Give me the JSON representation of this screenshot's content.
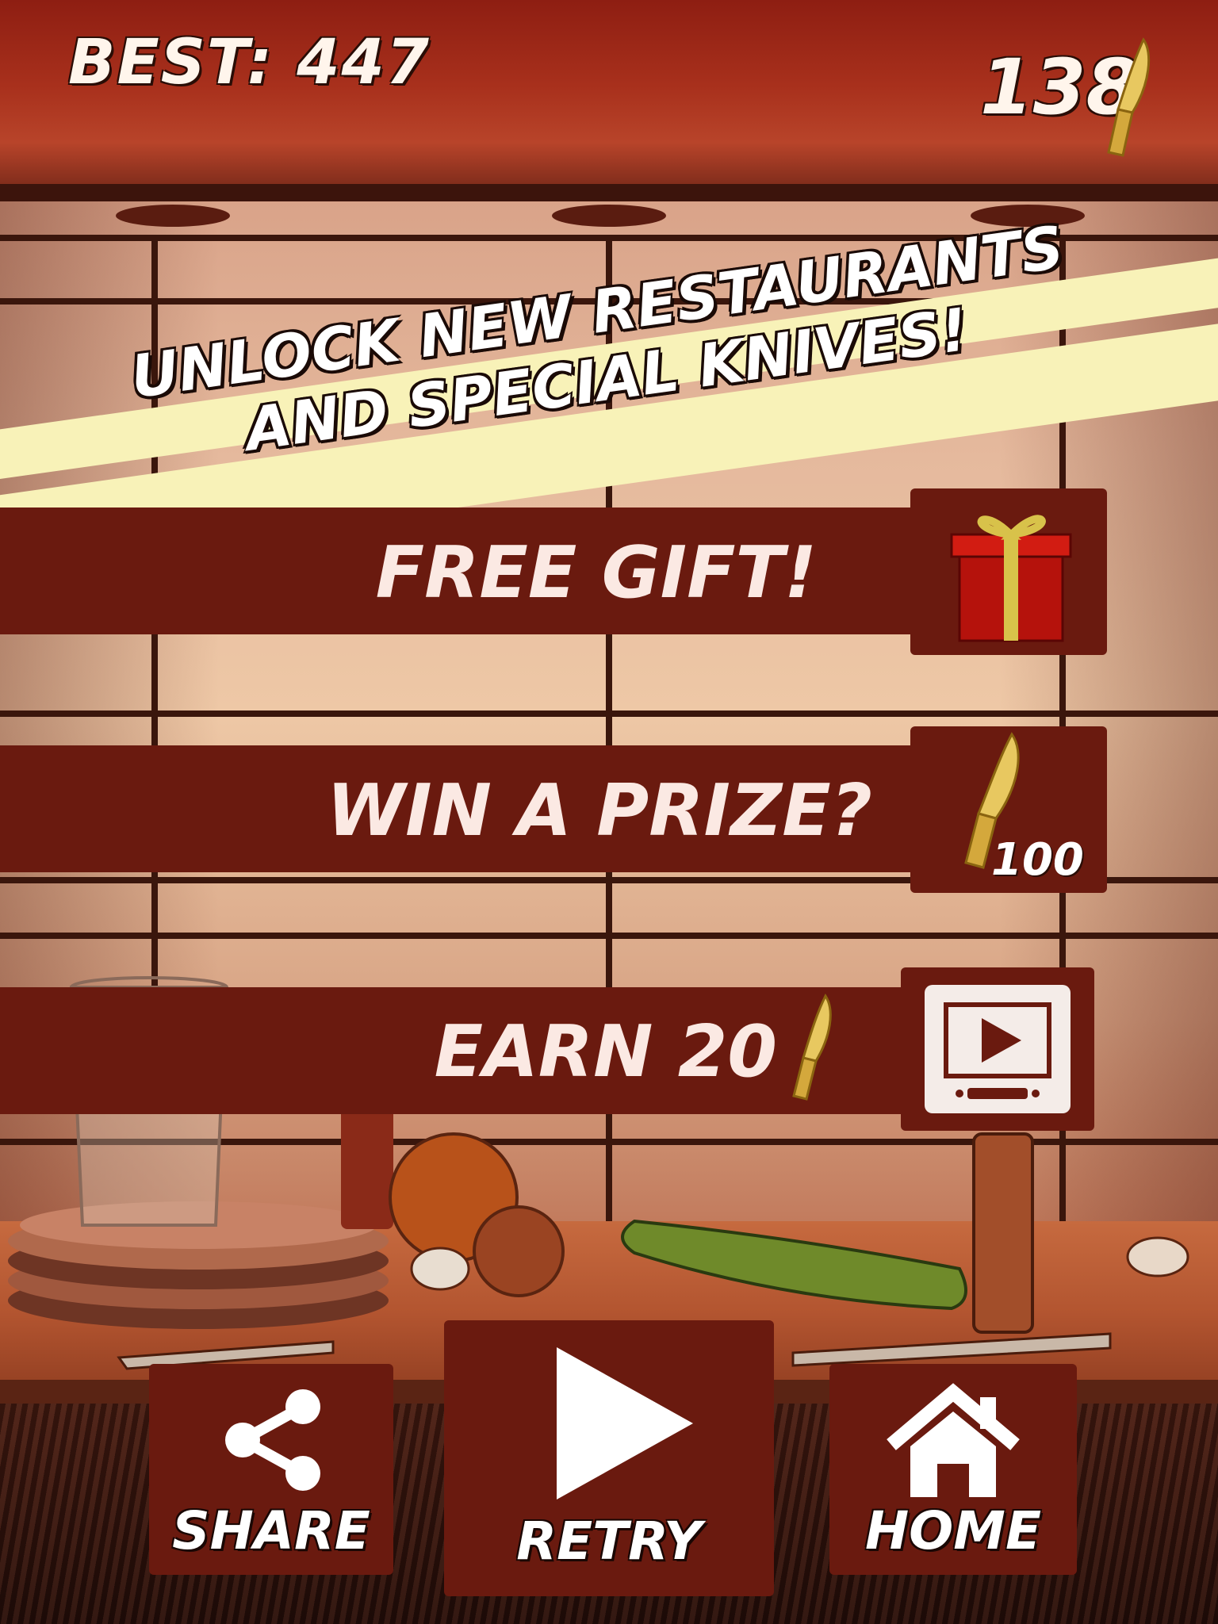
{
  "hud": {
    "best_label": "BEST: 447",
    "coin_count": "138",
    "coin_icon": "golden-knife-icon"
  },
  "banner": {
    "line1": "UNLOCK NEW RESTAURANTS",
    "line2": "AND SPECIAL KNIVES!"
  },
  "menu": {
    "free_gift": {
      "label": "FREE GIFT!",
      "icon": "gift-box-icon"
    },
    "win_prize": {
      "label": "WIN A PRIZE?",
      "cost": "100",
      "icon": "golden-knife-icon"
    },
    "earn": {
      "label": "EARN 20",
      "icon": "video-ad-icon"
    }
  },
  "buttons": {
    "share": {
      "label": "SHARE",
      "icon": "share-icon"
    },
    "retry": {
      "label": "RETRY",
      "icon": "play-icon"
    },
    "home": {
      "label": "HOME",
      "icon": "home-icon"
    }
  },
  "colors": {
    "panel": "#6a1a0f",
    "banner": "#f8f2b8",
    "knife_gold": "#e8c860",
    "gift_red": "#b5120c"
  }
}
